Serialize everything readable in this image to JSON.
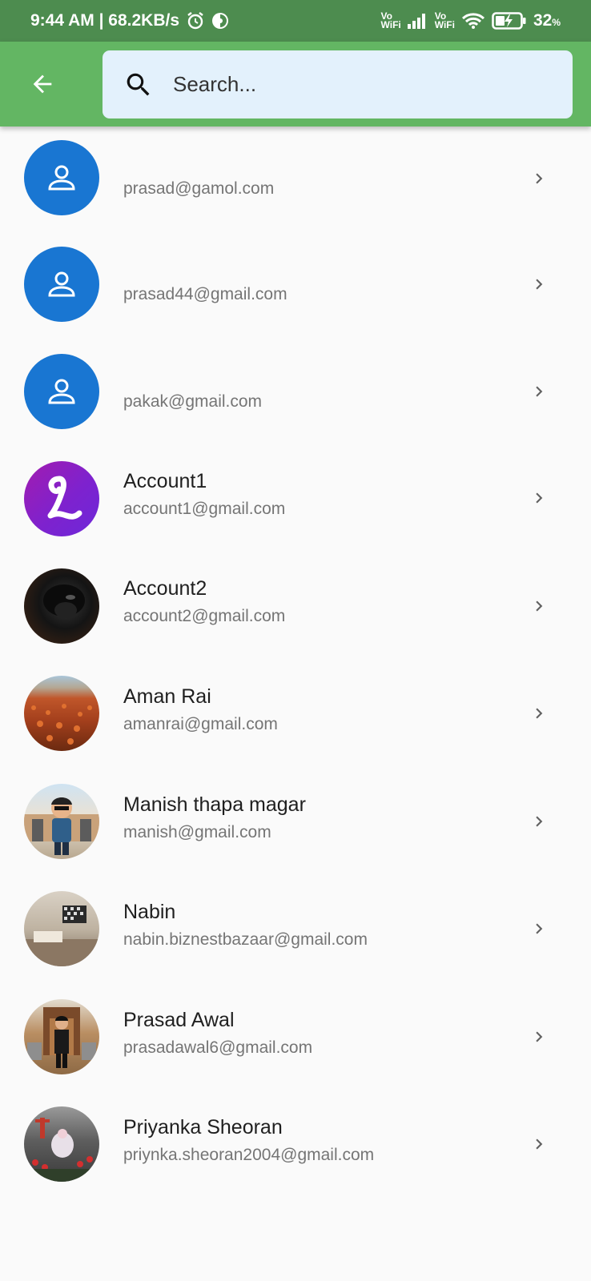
{
  "status_bar": {
    "time_speed": "9:44 AM | 68.2KB/s",
    "vo_wifi_1": "Vo\nWiFi",
    "vo_wifi_2": "Vo\nWiFi",
    "battery": "32",
    "battery_unit": "%"
  },
  "app_bar": {
    "back_icon": "arrow-left",
    "search_placeholder": "Search...",
    "search_value": ""
  },
  "colors": {
    "status_bar": "#4d8c4f",
    "app_bar": "#63b663",
    "search_bg": "#e3f1fc",
    "default_avatar": "#1976d2"
  },
  "contacts": [
    {
      "name": "",
      "email": "prasad@gamol.com",
      "avatar": "default-person-icon"
    },
    {
      "name": "",
      "email": "prasad44@gmail.com",
      "avatar": "default-person-icon"
    },
    {
      "name": "",
      "email": "pakak@gmail.com",
      "avatar": "default-person-icon"
    },
    {
      "name": "Account1",
      "email": "account1@gmail.com",
      "avatar": "letter-L-logo"
    },
    {
      "name": "Account2",
      "email": "account2@gmail.com",
      "avatar": "photo"
    },
    {
      "name": "Aman Rai",
      "email": "amanrai@gmail.com",
      "avatar": "photo"
    },
    {
      "name": "Manish thapa magar",
      "email": "manish@gmail.com",
      "avatar": "photo"
    },
    {
      "name": "Nabin",
      "email": "nabin.biznestbazaar@gmail.com",
      "avatar": "photo"
    },
    {
      "name": "Prasad Awal",
      "email": "prasadawal6@gmail.com",
      "avatar": "photo"
    },
    {
      "name": "Priyanka Sheoran",
      "email": "priynka.sheoran2004@gmail.com",
      "avatar": "photo"
    }
  ]
}
